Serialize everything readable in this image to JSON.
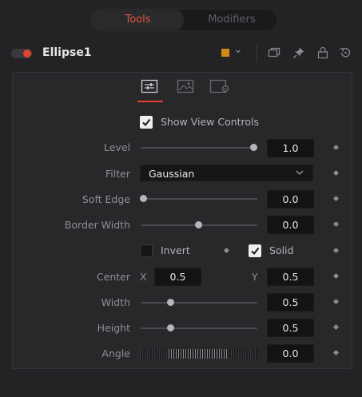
{
  "tabs": [
    {
      "label": "Tools"
    },
    {
      "label": "Modifiers"
    }
  ],
  "header": {
    "node_name": "Ellipse1",
    "color_swatch": "#d28a12",
    "accent": "#e0422c"
  },
  "panel_tabs": [
    "controls-icon",
    "image-icon",
    "settings-icon"
  ],
  "controls": {
    "show_view_controls": {
      "label": "Show View Controls",
      "checked": true
    },
    "level": {
      "label": "Level",
      "value": "1.0",
      "slider_fraction": 1.0
    },
    "filter": {
      "label": "Filter",
      "selected": "Gaussian"
    },
    "soft_edge": {
      "label": "Soft Edge",
      "value": "0.0",
      "slider_fraction": 0.0
    },
    "border_width": {
      "label": "Border Width",
      "value": "0.0",
      "slider_fraction": 0.5
    },
    "invert": {
      "label": "Invert",
      "checked": false
    },
    "solid": {
      "label": "Solid",
      "checked": true
    },
    "center": {
      "label": "Center",
      "x_label": "X",
      "x": "0.5",
      "y_label": "Y",
      "y": "0.5"
    },
    "width": {
      "label": "Width",
      "value": "0.5",
      "slider_fraction": 0.25
    },
    "height": {
      "label": "Height",
      "value": "0.5",
      "slider_fraction": 0.25
    },
    "angle": {
      "label": "Angle",
      "value": "0.0"
    }
  }
}
